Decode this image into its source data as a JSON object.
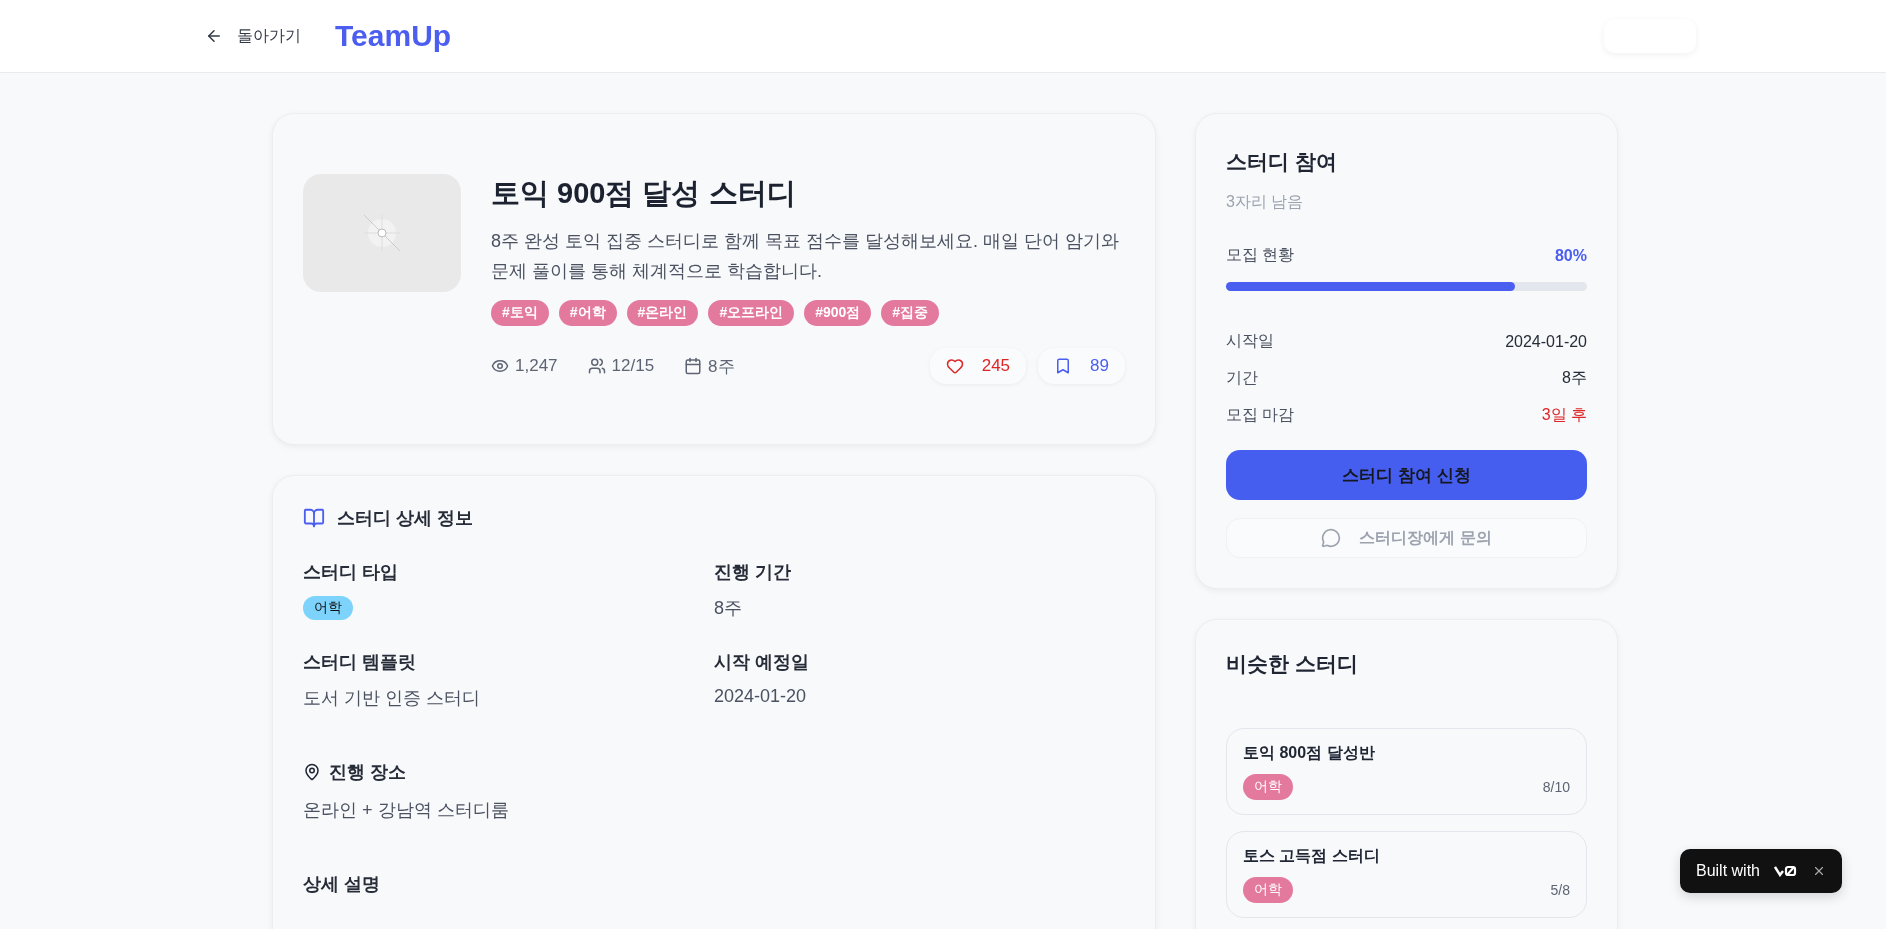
{
  "header": {
    "back_label": "돌아가기",
    "logo": "TeamUp"
  },
  "study": {
    "title": "토익 900점 달성 스터디",
    "description": "8주 완성 토익 집중 스터디로 함께 목표 점수를 달성해보세요. 매일 단어 암기와 문제 풀이를 통해 체계적으로 학습합니다.",
    "tags": [
      "#토익",
      "#어학",
      "#온라인",
      "#오프라인",
      "#900점",
      "#집중"
    ],
    "stats": [
      {
        "kind": "views",
        "text": "1,247"
      },
      {
        "kind": "members",
        "text": "12/15"
      },
      {
        "kind": "duration",
        "text": "8주"
      }
    ],
    "likes": "245",
    "bookmarks": "89"
  },
  "details": {
    "title": "스터디 상세 정보",
    "fields": [
      {
        "label": "스터디 타입",
        "value": "어학",
        "kind": "badge"
      },
      {
        "label": "진행 기간",
        "value": "8주",
        "kind": "text"
      },
      {
        "label": "스터디 템플릿",
        "value": "도서 기반 인증 스터디",
        "kind": "text"
      },
      {
        "label": "시작 예정일",
        "value": "2024-01-20",
        "kind": "text"
      }
    ],
    "location_label": "진행 장소",
    "location": "온라인 + 강남역 스터디룸",
    "description_label": "상세 설명"
  },
  "join": {
    "title": "스터디 참여",
    "remaining": "3자리 남음",
    "progress_label": "모집 현황",
    "progress_text": "80%",
    "level": 0.8,
    "rows": [
      {
        "label": "시작일",
        "value": "2024-01-20",
        "urgent": false
      },
      {
        "label": "기간",
        "value": "8주",
        "urgent": false
      },
      {
        "label": "모집 마감",
        "value": "3일 후",
        "urgent": true
      }
    ],
    "apply_button": "스터디 참여 신청",
    "contact_button": "스터디장에게 문의"
  },
  "similar": {
    "title": "비슷한 스터디",
    "items": [
      {
        "title": "토익 800점 달성반",
        "tag": "어학",
        "count": "8/10"
      },
      {
        "title": "토스 고득점 스터디",
        "tag": "어학",
        "count": "5/8"
      }
    ]
  },
  "badge": {
    "text": "Built with"
  }
}
